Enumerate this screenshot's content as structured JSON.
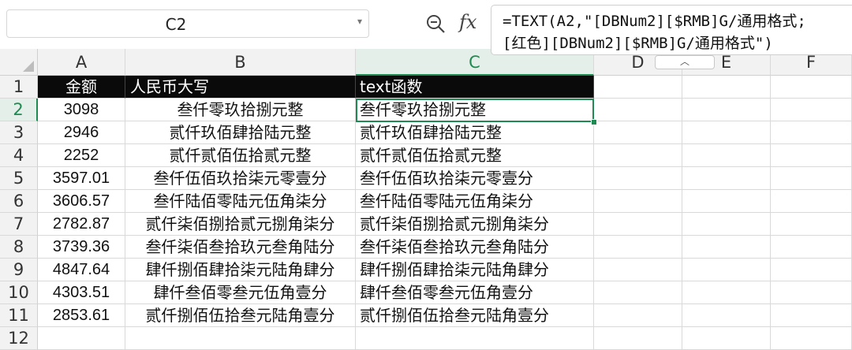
{
  "namebox": {
    "value": "C2"
  },
  "formula": {
    "line1": "=TEXT(A2,\"[DBNum2][$RMB]G/通用格式;",
    "line2": "[红色][DBNum2][$RMB]G/通用格式\")"
  },
  "columns": [
    "A",
    "B",
    "C",
    "D",
    "E",
    "F"
  ],
  "rows": [
    "1",
    "2",
    "3",
    "4",
    "5",
    "6",
    "7",
    "8",
    "9",
    "10",
    "11",
    "12"
  ],
  "header_row": {
    "a": "金额",
    "b": "人民币大写",
    "c": "text函数"
  },
  "data_rows": [
    {
      "a": "3098",
      "b": "叁仟零玖拾捌元整",
      "c": "叁仟零玖拾捌元整"
    },
    {
      "a": "2946",
      "b": "贰仟玖佰肆拾陆元整",
      "c": "贰仟玖佰肆拾陆元整"
    },
    {
      "a": "2252",
      "b": "贰仟贰佰伍拾贰元整",
      "c": "贰仟贰佰伍拾贰元整"
    },
    {
      "a": "3597.01",
      "b": "叁仟伍佰玖拾柒元零壹分",
      "c": "叁仟伍佰玖拾柒元零壹分"
    },
    {
      "a": "3606.57",
      "b": "叁仟陆佰零陆元伍角柒分",
      "c": "叁仟陆佰零陆元伍角柒分"
    },
    {
      "a": "2782.87",
      "b": "贰仟柒佰捌拾贰元捌角柒分",
      "c": "贰仟柒佰捌拾贰元捌角柒分"
    },
    {
      "a": "3739.36",
      "b": "叁仟柒佰叁拾玖元叁角陆分",
      "c": "叁仟柒佰叁拾玖元叁角陆分"
    },
    {
      "a": "4847.64",
      "b": "肆仟捌佰肆拾柒元陆角肆分",
      "c": "肆仟捌佰肆拾柒元陆角肆分"
    },
    {
      "a": "4303.51",
      "b": "肆仟叁佰零叁元伍角壹分",
      "c": "肆仟叁佰零叁元伍角壹分"
    },
    {
      "a": "2853.61",
      "b": "贰仟捌佰伍拾叁元陆角壹分",
      "c": "贰仟捌佰伍拾叁元陆角壹分"
    }
  ],
  "colors": {
    "accent": "#1f8a51",
    "header_fill": "#0a0a0a"
  },
  "icons": {
    "zoom": "zoom-formula-icon",
    "fx": "fx-icon",
    "dropdown": "chevron-down-icon",
    "collapse": "chevron-up-icon"
  }
}
